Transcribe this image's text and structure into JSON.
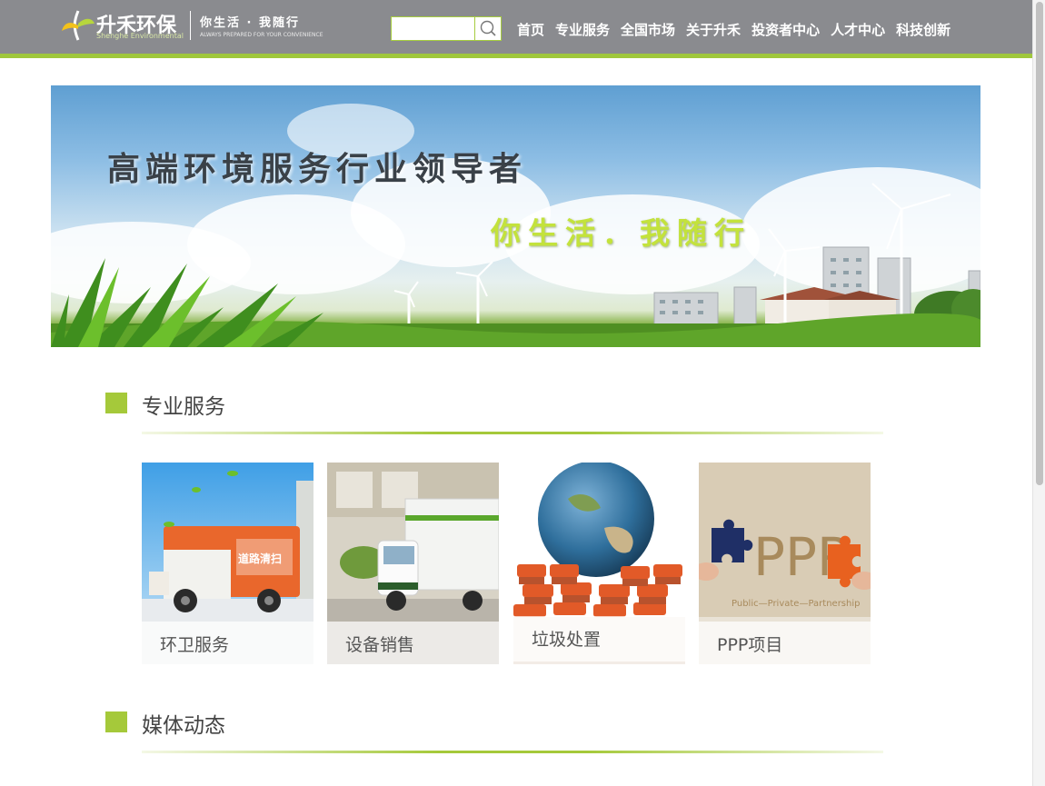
{
  "brand": {
    "name": "升禾环保",
    "name_en": "Shenghe Environmental",
    "slogan": "你生活 · 我随行",
    "slogan_en": "ALWAYS PREPARED FOR YOUR CONVENIENCE"
  },
  "search": {
    "value": "",
    "placeholder": ""
  },
  "nav": {
    "items": [
      {
        "label": "首页"
      },
      {
        "label": "专业服务"
      },
      {
        "label": "全国市场"
      },
      {
        "label": "关于升禾"
      },
      {
        "label": "投资者中心"
      },
      {
        "label": "人才中心"
      },
      {
        "label": "科技创新"
      }
    ]
  },
  "banner": {
    "title": "高端环境服务行业领导者",
    "subtitle": "你生活．我随行"
  },
  "services": {
    "title": "专业服务",
    "cards": [
      {
        "label": "环卫服务"
      },
      {
        "label": "设备销售"
      },
      {
        "label": "垃圾处置"
      },
      {
        "label": "PPP项目"
      }
    ],
    "truck_sign": "道路清扫",
    "ppp_text": "PPP",
    "ppp_sub": "Public—Private—Partnership"
  },
  "media": {
    "title": "媒体动态"
  },
  "colors": {
    "header_bg": "#8a8b8f",
    "accent_green": "#9fc73c",
    "section_square": "#a5c93a"
  }
}
